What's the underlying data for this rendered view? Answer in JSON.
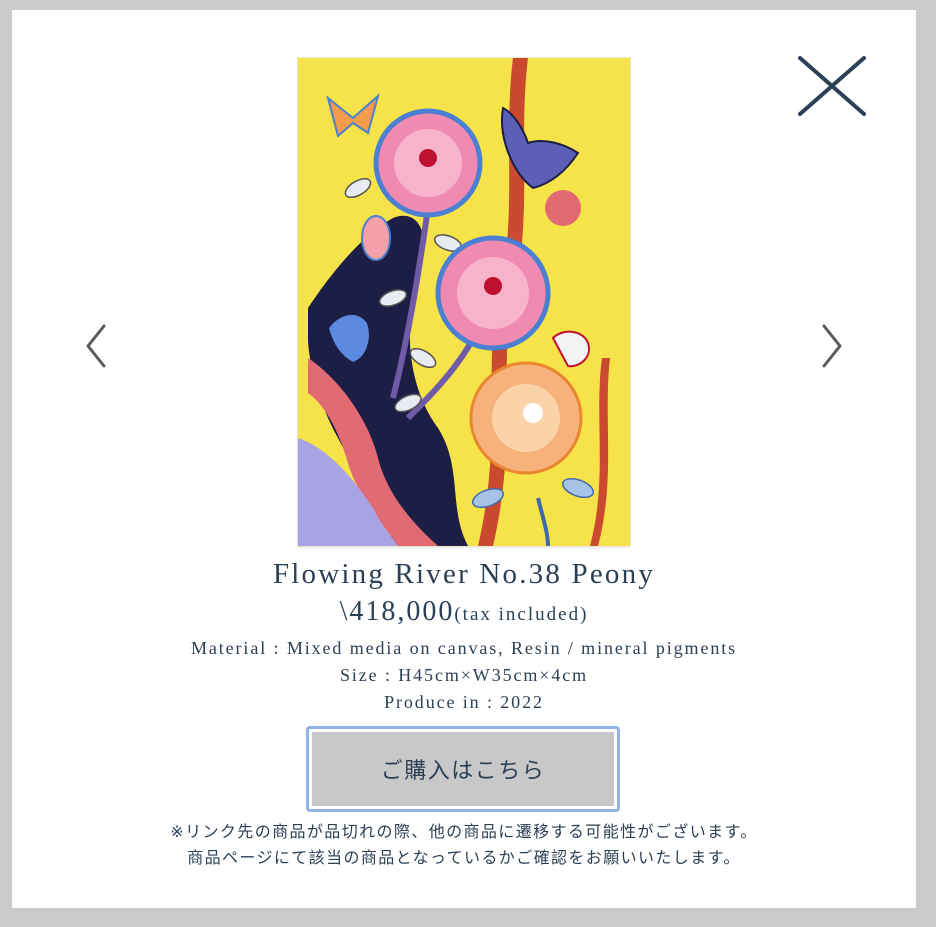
{
  "modal": {
    "close_icon": "close-icon",
    "prev_icon": "chevron-left-icon",
    "next_icon": "chevron-right-icon",
    "artwork_title": "Flowing River No.38 Peony",
    "price": "\\418,000",
    "tax_note": "(tax included)",
    "material": "Material : Mixed media on canvas, Resin / mineral pigments",
    "size": "Size : H45cm×W35cm×4cm",
    "produce": "Produce in : 2022",
    "buy_label": "ご購入はこちら",
    "note_line1": "※リンク先の商品が品切れの際、他の商品に遷移する可能性がございます。",
    "note_line2": "商品ページにて該当の商品となっているかご確認をお願いいたします。"
  },
  "colors": {
    "text": "#2b3f55",
    "button_fill": "#c8c8c8",
    "button_focus_ring": "#8fb4e8",
    "overlay": "#cbcbcb"
  }
}
